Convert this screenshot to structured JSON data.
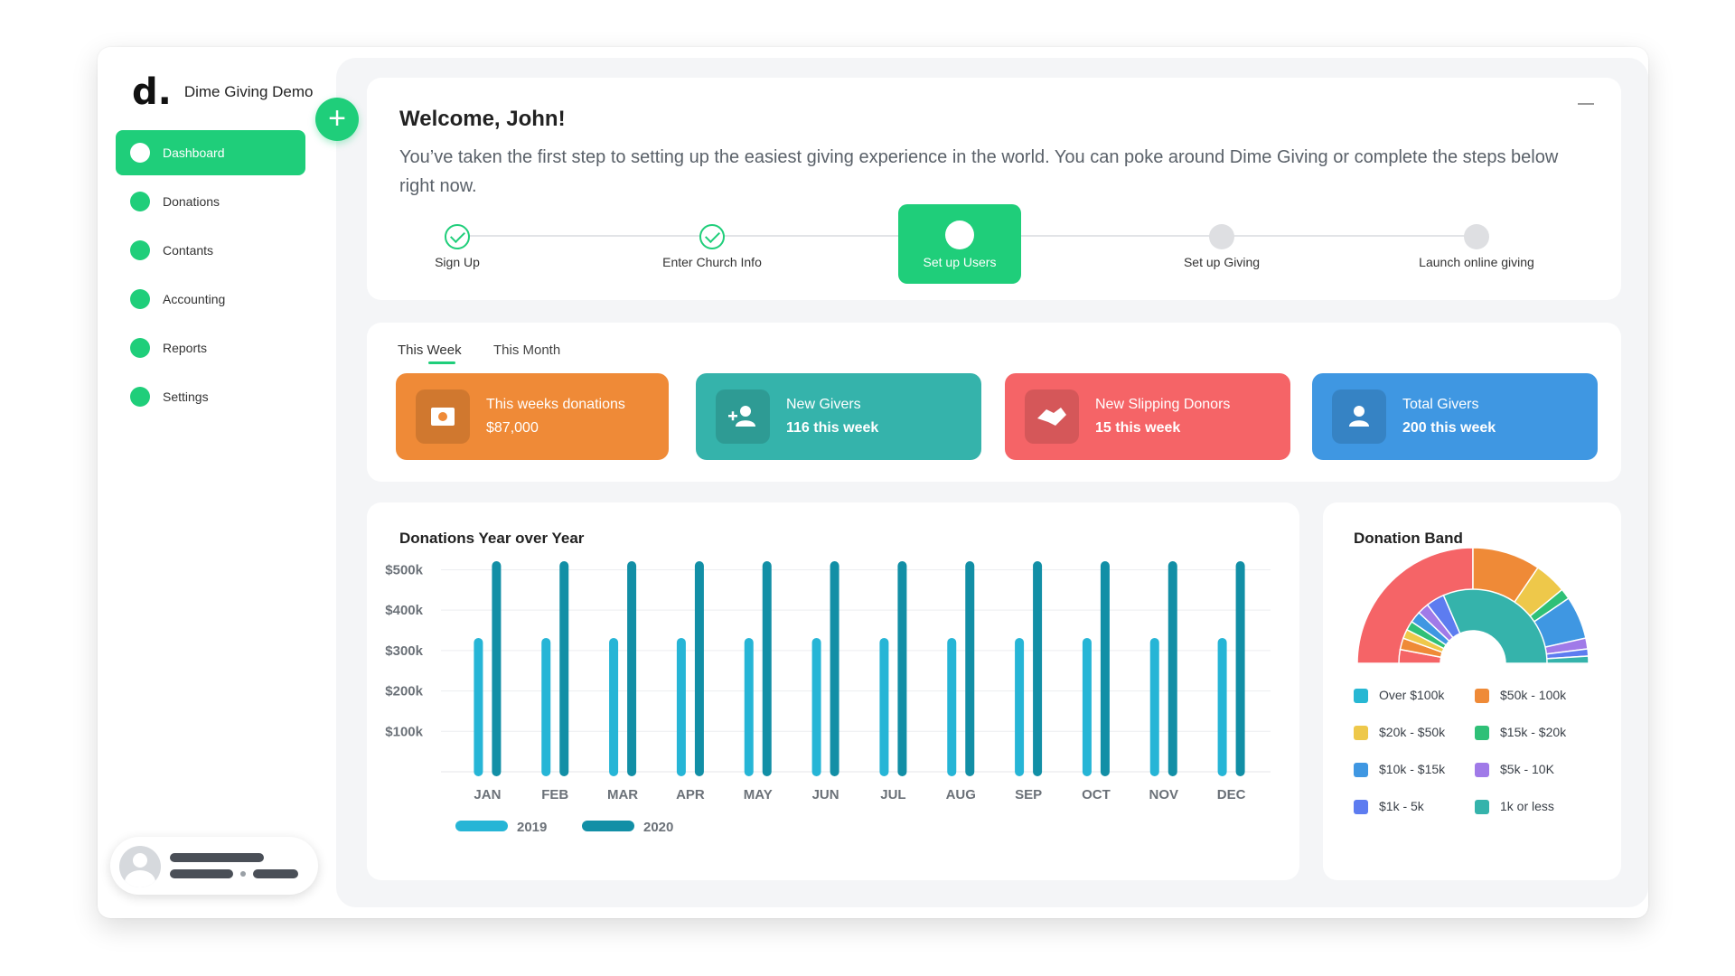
{
  "app": {
    "logo_mark": "d.",
    "name": "Dime Giving Demo"
  },
  "sidebar": {
    "items": [
      {
        "label": "Dashboard",
        "active": true
      },
      {
        "label": "Donations"
      },
      {
        "label": "Contants"
      },
      {
        "label": "Accounting"
      },
      {
        "label": "Reports"
      },
      {
        "label": "Settings"
      }
    ],
    "add_icon": "plus-icon",
    "user_icon": "user-avatar-icon"
  },
  "welcome": {
    "title": "Welcome, John!",
    "text": "You’ve taken the first step to setting up the easiest giving experience in the world. You can poke around Dime Giving or complete the steps below right now.",
    "steps": [
      {
        "label": "Sign Up",
        "status": "done"
      },
      {
        "label": "Enter Church Info",
        "status": "done"
      },
      {
        "label": "Set up Users",
        "status": "active"
      },
      {
        "label": "Set up Giving",
        "status": "todo"
      },
      {
        "label": "Launch online giving",
        "status": "todo"
      }
    ]
  },
  "stats": {
    "tabs": [
      {
        "label": "This Week",
        "active": true
      },
      {
        "label": "This Month"
      }
    ],
    "cards": [
      {
        "title": "This weeks donations",
        "value": "$87,000",
        "color": "#ef8a37",
        "icon": "money-icon"
      },
      {
        "title": "New Givers",
        "value": "116 this week",
        "color": "#35b3ab",
        "icon": "add-user-icon"
      },
      {
        "title": "New Slipping Donors",
        "value": "15 this week",
        "color": "#f56467",
        "icon": "handshake-icon"
      },
      {
        "title": "Total Givers",
        "value": "200 this week",
        "color": "#3f97e2",
        "icon": "person-icon"
      }
    ]
  },
  "colors": {
    "accent": "#1fce7a",
    "series_2019": "#26b5d6",
    "series_2020": "#128fa6"
  },
  "chart_data": [
    {
      "type": "bar",
      "title": "Donations Year over Year",
      "categories": [
        "JAN",
        "FEB",
        "MAR",
        "APR",
        "MAY",
        "JUN",
        "JUL",
        "AUG",
        "SEP",
        "OCT",
        "NOV",
        "DEC"
      ],
      "series": [
        {
          "name": "2019",
          "values": [
            320,
            320,
            320,
            320,
            320,
            320,
            320,
            320,
            320,
            320,
            320,
            320
          ]
        },
        {
          "name": "2020",
          "values": [
            510,
            510,
            510,
            510,
            510,
            510,
            510,
            510,
            510,
            510,
            510,
            510
          ]
        }
      ],
      "y_ticks": [
        "$100k",
        "$200k",
        "$300k",
        "$400k",
        "$500k"
      ],
      "ylim": [
        0,
        510
      ],
      "grid": true,
      "legend": "bottom-left"
    },
    {
      "type": "pie",
      "subtype": "semi-donut",
      "title": "Donation Band",
      "legend": "bottom",
      "categories": [
        "Over $100k",
        "$50k - 100k",
        "$20k - $50k",
        "$15k - $20k",
        "$10k - $15k",
        "$5k - 10K",
        "$1k - 5k",
        "1k or less"
      ],
      "colors": [
        "#27b7d3",
        "#ef8a37",
        "#eec84a",
        "#2fc077",
        "#3f97e2",
        "#a07ae8",
        "#5d7cf0",
        "#35b3ab"
      ],
      "rings": [
        {
          "ring": "outer",
          "slices": [
            {
              "label": "red",
              "value": 50,
              "color": "#f56467"
            },
            {
              "label": "$50k - 100k",
              "value": 19,
              "color": "#ef8a37"
            },
            {
              "label": "$20k - $50k",
              "value": 9,
              "color": "#eec84a"
            },
            {
              "label": "$15k - $20k",
              "value": 3,
              "color": "#2fc077"
            },
            {
              "label": "$10k - $15k",
              "value": 12,
              "color": "#3f97e2"
            },
            {
              "label": "$5k - 10K",
              "value": 3,
              "color": "#a07ae8"
            },
            {
              "label": "$1k - 5k",
              "value": 2,
              "color": "#5d7cf0"
            },
            {
              "label": "1k or less",
              "value": 2,
              "color": "#35b3ab"
            }
          ]
        },
        {
          "ring": "inner",
          "slices": [
            {
              "label": "red",
              "value": 6,
              "color": "#f56467"
            },
            {
              "label": "$50k - 100k",
              "value": 5,
              "color": "#ef8a37"
            },
            {
              "label": "$20k - $50k",
              "value": 4,
              "color": "#eec84a"
            },
            {
              "label": "$15k - $20k",
              "value": 4,
              "color": "#2fc077"
            },
            {
              "label": "$10k - $15k",
              "value": 5,
              "color": "#3f97e2"
            },
            {
              "label": "$5k - 10K",
              "value": 5,
              "color": "#a07ae8"
            },
            {
              "label": "$1k - 5k",
              "value": 8,
              "color": "#5d7cf0"
            },
            {
              "label": "1k or less",
              "value": 63,
              "color": "#35b3ab"
            }
          ]
        }
      ]
    }
  ]
}
